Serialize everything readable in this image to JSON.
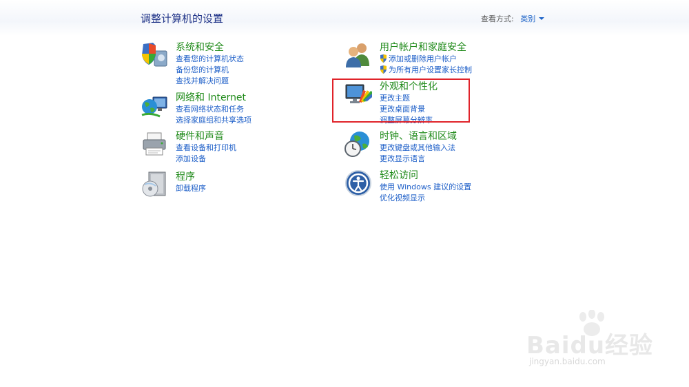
{
  "header": {
    "title": "调整计算机的设置",
    "view_by_label": "查看方式:",
    "view_by_value": "类别"
  },
  "categories": [
    {
      "title": "系统和安全",
      "links": [
        "查看您的计算机状态",
        "备份您的计算机",
        "查找并解决问题"
      ]
    },
    {
      "title": "网络和 Internet",
      "links": [
        "查看网络状态和任务",
        "选择家庭组和共享选项"
      ]
    },
    {
      "title": "硬件和声音",
      "links": [
        "查看设备和打印机",
        "添加设备"
      ]
    },
    {
      "title": "程序",
      "links": [
        "卸载程序"
      ]
    },
    {
      "title": "用户帐户和家庭安全",
      "links": [
        "添加或删除用户帐户",
        "为所有用户设置家长控制"
      ]
    },
    {
      "title": "外观和个性化",
      "links": [
        "更改主题",
        "更改桌面背景",
        "调整屏幕分辨率"
      ]
    },
    {
      "title": "时钟、语言和区域",
      "links": [
        "更改键盘或其他输入法",
        "更改显示语言"
      ]
    },
    {
      "title": "轻松访问",
      "links": [
        "使用 Windows 建议的设置",
        "优化视频显示"
      ]
    }
  ],
  "watermark": {
    "brand": "Baidu经验",
    "sub": "jingyan.baidu.com"
  },
  "colors": {
    "title_blue": "#1e3287",
    "category_green": "#1f8a19",
    "link_blue": "#1e5fc8",
    "highlight_red": "#e0232a"
  }
}
